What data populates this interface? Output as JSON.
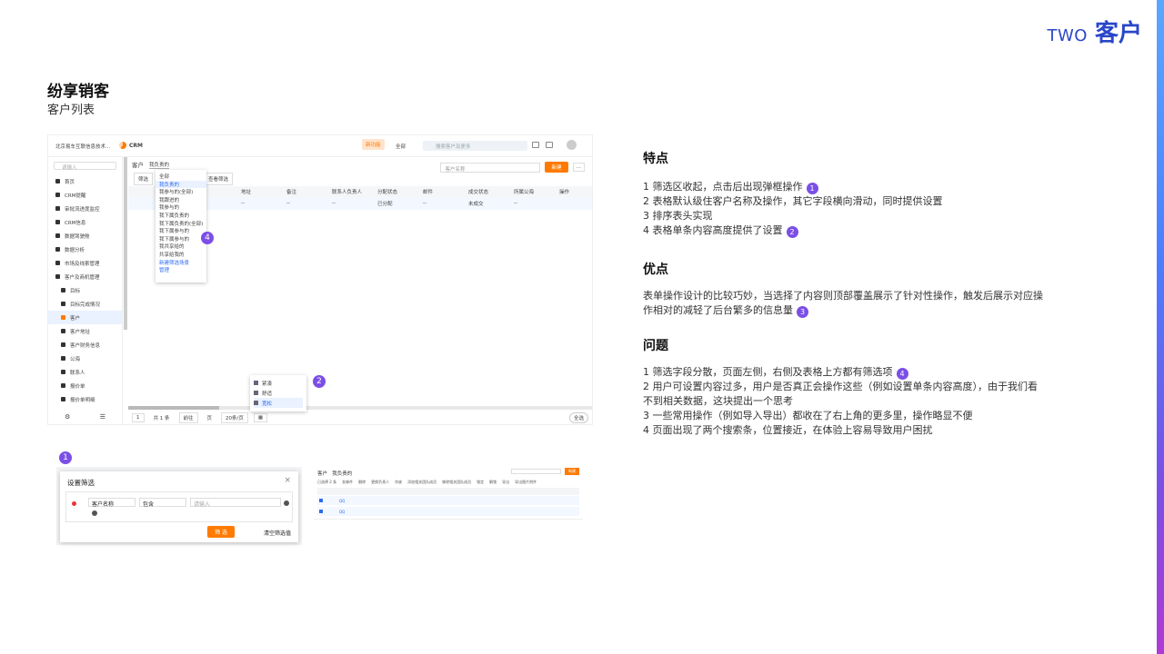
{
  "section": {
    "en": "TWO",
    "zh": "客户"
  },
  "page_title": "纷享销客",
  "page_subtitle": "客户列表",
  "crm": {
    "company": "北京易车互联信息技术...",
    "app": "CRM",
    "new_badge": "新功能",
    "scope": "全部",
    "search_placeholder": "搜索客户及更多",
    "side_search_placeholder": "请输入",
    "menu": [
      "首页",
      "CRM提醒",
      "审批流进度监控",
      "CRM信息",
      "数据驾驶舱",
      "数据分析",
      "市场及线索管理",
      "客户及商机管理",
      "目标",
      "目标完成情况",
      "客户",
      "客户地址",
      "客户财务信息",
      "公海",
      "联系人",
      "报价单",
      "报价单明细"
    ],
    "list_title": "客户",
    "view_select": "我负责的",
    "filter_placeholder": "客户名称",
    "new_button": "新建",
    "toolbar": [
      "筛选",
      "查看筛选"
    ],
    "columns": [
      "",
      "",
      "",
      "",
      "地址",
      "备注",
      "联系人负责人",
      "分配状态",
      "邮件",
      "成交状态",
      "所属公海",
      "操作"
    ],
    "row": [
      "--",
      "--",
      "--",
      "已分配",
      "--",
      "未成交",
      "--"
    ],
    "dropdown": [
      "全部",
      "我负责的",
      "我参与的(全部)",
      "我跟进的",
      "我参与的",
      "我下属负责的",
      "我下属负责的(全部)",
      "我下属参与的",
      "我下属参与的",
      "我共享给的",
      "共享给我的"
    ],
    "dropdown_footer": [
      "新建筛选场景",
      "管理"
    ],
    "height_options": [
      "紧凑",
      "舒适",
      "宽松"
    ],
    "pager": {
      "total": "共 1 条",
      "goto": "前往",
      "page_unit": "页",
      "per_page": "20条/页"
    },
    "toggle": "全选"
  },
  "dialog": {
    "title": "设置筛选",
    "field": "客户名称",
    "operator": "包含",
    "value_placeholder": "请输入",
    "ok": "筛 选",
    "clear": "清空筛选值"
  },
  "table_snapshot": {
    "title": "客户",
    "view": "我负责的",
    "selected": "已选择 2 条",
    "actions": [
      "发邮件",
      "删除",
      "更换负责人",
      "作废",
      "添加相关团队成员",
      "移除相关团队成员",
      "锁定",
      "解锁",
      "导出",
      "导出图片附件"
    ],
    "new": "新建",
    "rows": [
      "QQ",
      "QQ"
    ]
  },
  "features": {
    "title": "特点",
    "items": [
      "1 筛选区收起，点击后出现弹框操作",
      "2 表格默认级住客户名称及操作，其它字段横向滑动，同时提供设置",
      "3 排序表头实现",
      "4 表格单条内容高度提供了设置"
    ],
    "markers": [
      "1",
      "",
      "",
      "2"
    ]
  },
  "pros": {
    "title": "优点",
    "text": "表单操作设计的比较巧妙，当选择了内容则顶部覆盖展示了针对性操作，触发后展示对应操作相对的减轻了后台繁多的信息量",
    "marker": "3"
  },
  "issues": {
    "title": "问题",
    "items": [
      "1 筛选字段分散，页面左侧，右侧及表格上方都有筛选项",
      "2 用户可设置内容过多，用户是否真正会操作这些（例如设置单条内容高度），由于我们看不到相关数据，这块提出一个思考",
      "3 一些常用操作（例如导入导出）都收在了右上角的更多里，操作略显不便",
      "4 页面出现了两个搜索条，位置接近，在体验上容易导致用户困扰"
    ],
    "marker": "4"
  },
  "marker_labels": [
    "1",
    "2",
    "3",
    "4"
  ],
  "colors": {
    "accent": "#2a46c9",
    "marker": "#7b4fe6",
    "brand_orange": "#ff7a00"
  }
}
